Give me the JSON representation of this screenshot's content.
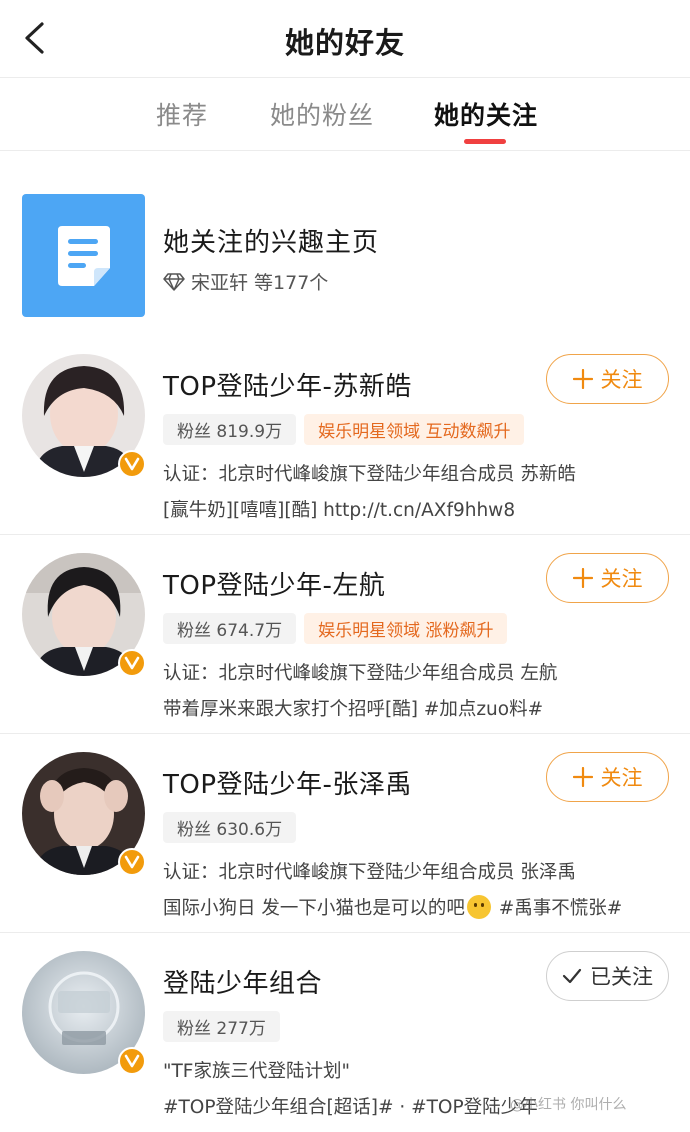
{
  "header": {
    "back_icon": "chevron-left-icon",
    "title": "她的好友"
  },
  "tabs": [
    {
      "label": "推荐",
      "active": false
    },
    {
      "label": "她的粉丝",
      "active": false
    },
    {
      "label": "她的关注",
      "active": true
    }
  ],
  "interest": {
    "icon": "document-icon",
    "title": "她关注的兴趣主页",
    "diamond_icon": "diamond-icon",
    "subtitle": "宋亚轩 等177个"
  },
  "users": [
    {
      "name": "TOP登陆少年-苏新皓",
      "fans": "粉丝 819.9万",
      "domain_tag": "娱乐明星领域 互动数飙升",
      "line1": "认证：北京时代峰峻旗下登陆少年组合成员 苏新皓",
      "line2": "[赢牛奶][嘻嘻][酷] http://t.cn/AXf9hhw8",
      "follow_label": "关注",
      "verified": true
    },
    {
      "name": "TOP登陆少年-左航",
      "fans": "粉丝 674.7万",
      "domain_tag": "娱乐明星领域 涨粉飙升",
      "line1": "认证：北京时代峰峻旗下登陆少年组合成员 左航",
      "line2": "带着厚米来跟大家打个招呼[酷] #加点zuo料#",
      "follow_label": "关注",
      "verified": true
    },
    {
      "name": "TOP登陆少年-张泽禹",
      "fans": "粉丝 630.6万",
      "domain_tag": "",
      "line1": "认证：北京时代峰峻旗下登陆少年组合成员 张泽禹",
      "line2_a": "国际小狗日 发一下小猫也是可以的吧",
      "line2_b": " #禹事不慌张#",
      "follow_label": "关注",
      "verified": true
    },
    {
      "name": "登陆少年组合",
      "fans": "粉丝 277万",
      "domain_tag": "",
      "line1": "\"TF家族三代登陆计划\"",
      "line2": "#TOP登陆少年组合[超话]# · #TOP登陆少年",
      "follow_label": "已关注",
      "verified": true
    }
  ],
  "watermark": "@小红书 你叫什么"
}
